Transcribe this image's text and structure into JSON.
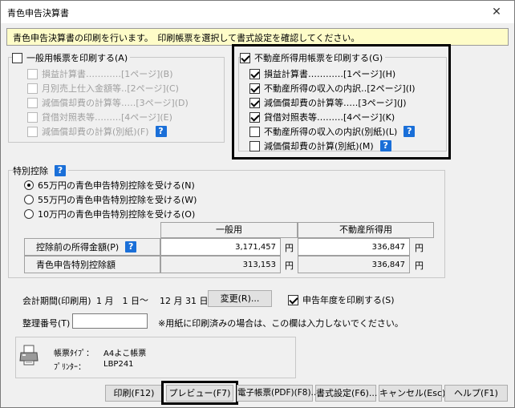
{
  "window": {
    "title": "青色申告決算書",
    "close_glyph": "✕"
  },
  "info_message": "青色申告決算書の印刷を行います。　印刷帳票を選択して書式設定を確認してください。",
  "general_forms": {
    "legend": "一般用帳票を印刷する(A)",
    "checked": false,
    "items": [
      {
        "label": "損益計算書…………[1ページ](B)",
        "checked": false
      },
      {
        "label": "月別売上仕入金額等‥[2ページ](C)",
        "checked": false
      },
      {
        "label": "減価償却費の計算等‥…[3ページ](D)",
        "checked": false
      },
      {
        "label": "貸借対照表等………[4ページ](E)",
        "checked": false
      },
      {
        "label": "減価償却費の計算(別紙)(F)",
        "checked": false,
        "help": "?"
      }
    ]
  },
  "realestate_forms": {
    "legend": "不動産所得用帳票を印刷する(G)",
    "checked": true,
    "items": [
      {
        "label": "損益計算書…………[1ページ](H)",
        "checked": true
      },
      {
        "label": "不動産所得の収入の内訳‥[2ページ](I)",
        "checked": true
      },
      {
        "label": "減価償却費の計算等…‥[3ページ](J)",
        "checked": true
      },
      {
        "label": "貸借対照表等………[4ページ](K)",
        "checked": true
      },
      {
        "label": "不動産所得の収入の内訳(別紙)(L)",
        "checked": false,
        "help": "?"
      },
      {
        "label": "減価償却費の計算(別紙)(M)",
        "checked": false,
        "help": "?"
      }
    ]
  },
  "special_deduction": {
    "legend": "特別控除",
    "help": "?",
    "options": [
      {
        "label": "65万円の青色申告特別控除を受ける(N)",
        "selected": true
      },
      {
        "label": "55万円の青色申告特別控除を受ける(W)",
        "selected": false
      },
      {
        "label": "10万円の青色申告特別控除を受ける(O)",
        "selected": false
      }
    ],
    "table": {
      "col_general": "一般用",
      "col_realestate": "不動産所得用",
      "rows": [
        {
          "label": "控除前の所得金額(P)",
          "help": "?",
          "general": "3,171,457",
          "realestate": "336,847",
          "unit": "円"
        },
        {
          "label": "青色申告特別控除額",
          "general": "313,153",
          "realestate": "336,847",
          "unit": "円"
        }
      ]
    }
  },
  "period": {
    "label": "会計期間(印刷用)",
    "start": "1 月　1 日",
    "tilde": "～",
    "end": "12 月 31 日",
    "change_button": "変更(R)...",
    "print_year_label": "申告年度を印刷する(S)",
    "print_year_checked": true
  },
  "ref_number": {
    "label": "整理番号(T)",
    "value": "",
    "note": "※用紙に印刷済みの場合は、この欄は入力しないでください。"
  },
  "printer_info": {
    "form_type_label": "帳票ﾀｲﾌﾟ：",
    "form_type_value": "A4よこ帳票",
    "printer_label": "ﾌﾟﾘﾝﾀｰ：",
    "printer_value": "LBP241"
  },
  "buttons": {
    "print": "印刷(F12)",
    "preview": "プレビュー(F7)",
    "epdf": "電子帳票(PDF)(F8)...",
    "format": "書式設定(F6)...",
    "cancel": "キャンセル(Esc)",
    "help": "ヘルプ(F1)"
  }
}
